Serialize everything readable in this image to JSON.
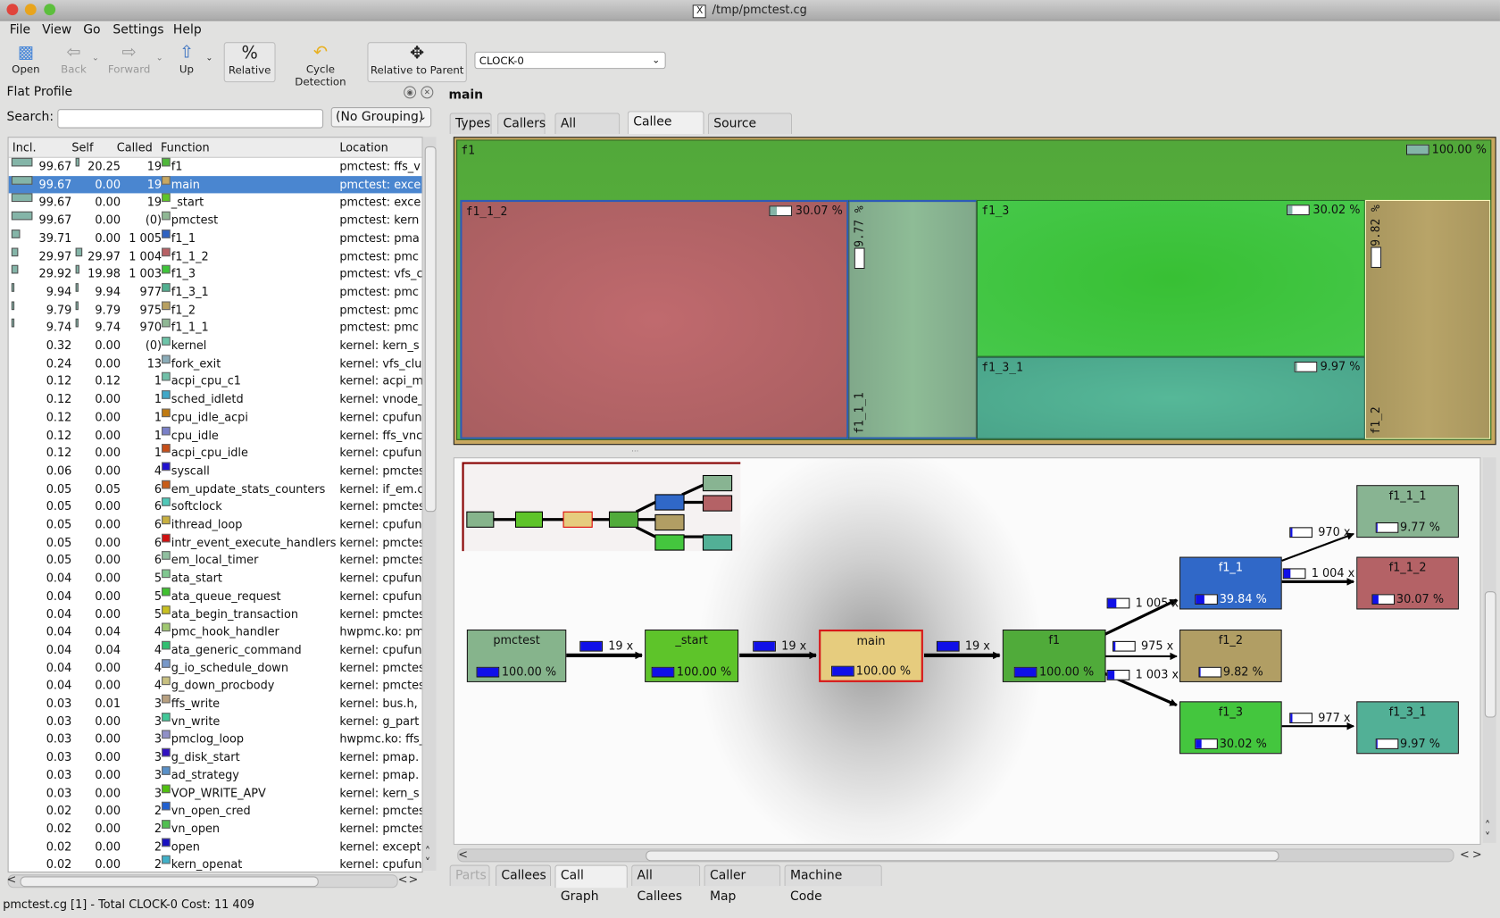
{
  "window": {
    "title": "/tmp/pmctest.cg"
  },
  "menu": [
    "File",
    "View",
    "Go",
    "Settings",
    "Help"
  ],
  "toolbar": {
    "open": "Open",
    "back": "Back",
    "forward": "Forward",
    "up": "Up",
    "relative": "Relative",
    "cycle_detection": "Cycle Detection",
    "relative_to_parent": "Relative to Parent",
    "event_type": "CLOCK-0"
  },
  "flat_profile": {
    "title": "Flat Profile",
    "search_label": "Search:",
    "search_value": "",
    "grouping": "(No Grouping)",
    "columns": [
      "Incl.",
      "Self",
      "Called",
      "Function",
      "Location"
    ],
    "rows": [
      {
        "incl": "99.67",
        "self": "20.25",
        "called": "19",
        "func": "f1",
        "loc": "pmctest: ffs_v",
        "color": "#4fb83a",
        "ibar": 1.0,
        "sbar": 0.2
      },
      {
        "incl": "99.67",
        "self": "0.00",
        "called": "19",
        "func": "main",
        "loc": "pmctest: exce",
        "color": "#c8a860",
        "ibar": 1.0,
        "sbar": 0,
        "selected": true
      },
      {
        "incl": "99.67",
        "self": "0.00",
        "called": "19",
        "func": "_start",
        "loc": "pmctest: exce",
        "color": "#5ec42a",
        "ibar": 1.0,
        "sbar": 0
      },
      {
        "incl": "99.67",
        "self": "0.00",
        "called": "(0)",
        "func": "pmctest",
        "loc": "pmctest: kern",
        "color": "#8fb894",
        "ibar": 1.0,
        "sbar": 0
      },
      {
        "incl": "39.71",
        "self": "0.00",
        "called": "1 005",
        "func": "f1_1",
        "loc": "pmctest: pma",
        "color": "#2f62c2",
        "ibar": 0.4,
        "sbar": 0
      },
      {
        "incl": "29.97",
        "self": "29.97",
        "called": "1 004",
        "func": "f1_1_2",
        "loc": "pmctest: pmc",
        "color": "#b86064",
        "ibar": 0.3,
        "sbar": 0.3
      },
      {
        "incl": "29.92",
        "self": "19.98",
        "called": "1 003",
        "func": "f1_3",
        "loc": "pmctest: vfs_c",
        "color": "#3ec43a",
        "ibar": 0.3,
        "sbar": 0.2
      },
      {
        "incl": "9.94",
        "self": "9.94",
        "called": "977",
        "func": "f1_3_1",
        "loc": "pmctest: pmc",
        "color": "#50b090",
        "ibar": 0.1,
        "sbar": 0.1
      },
      {
        "incl": "9.79",
        "self": "9.79",
        "called": "975",
        "func": "f1_2",
        "loc": "pmctest: pmc",
        "color": "#b8a060",
        "ibar": 0.1,
        "sbar": 0.1
      },
      {
        "incl": "9.74",
        "self": "9.74",
        "called": "970",
        "func": "f1_1_1",
        "loc": "pmctest: pmc",
        "color": "#8fb894",
        "ibar": 0.1,
        "sbar": 0.1
      },
      {
        "incl": "0.32",
        "self": "0.00",
        "called": "(0)",
        "func": "kernel",
        "loc": "kernel: kern_s",
        "color": "#6cc4a8"
      },
      {
        "incl": "0.24",
        "self": "0.00",
        "called": "13",
        "func": "fork_exit",
        "loc": "kernel: vfs_clu",
        "color": "#8aacb8"
      },
      {
        "incl": "0.12",
        "self": "0.12",
        "called": "1",
        "func": "acpi_cpu_c1",
        "loc": "kernel: acpi_m",
        "color": "#70c0a8"
      },
      {
        "incl": "0.12",
        "self": "0.00",
        "called": "1",
        "func": "sched_idletd",
        "loc": "kernel: vnode_",
        "color": "#40a8c8"
      },
      {
        "incl": "0.12",
        "self": "0.00",
        "called": "1",
        "func": "cpu_idle_acpi",
        "loc": "kernel: cpufun",
        "color": "#c07a10"
      },
      {
        "incl": "0.12",
        "self": "0.00",
        "called": "1",
        "func": "cpu_idle",
        "loc": "kernel: ffs_vnc",
        "color": "#7a80c8"
      },
      {
        "incl": "0.12",
        "self": "0.00",
        "called": "1",
        "func": "acpi_cpu_idle",
        "loc": "kernel: cpufun",
        "color": "#c84e18"
      },
      {
        "incl": "0.06",
        "self": "0.00",
        "called": "4",
        "func": "syscall",
        "loc": "kernel: pmctes",
        "color": "#2010d0"
      },
      {
        "incl": "0.05",
        "self": "0.05",
        "called": "6",
        "func": "em_update_stats_counters",
        "loc": "kernel: if_em.c",
        "color": "#c85c18"
      },
      {
        "incl": "0.05",
        "self": "0.00",
        "called": "6",
        "func": "softclock",
        "loc": "kernel: pmctes",
        "color": "#50c8b8"
      },
      {
        "incl": "0.05",
        "self": "0.00",
        "called": "6",
        "func": "ithread_loop",
        "loc": "kernel: cpufun",
        "color": "#c8b040"
      },
      {
        "incl": "0.05",
        "self": "0.00",
        "called": "6",
        "func": "intr_event_execute_handlers",
        "loc": "kernel: pmctes",
        "color": "#d01010"
      },
      {
        "incl": "0.05",
        "self": "0.00",
        "called": "6",
        "func": "em_local_timer",
        "loc": "kernel: pmctes",
        "color": "#90c0a0"
      },
      {
        "incl": "0.04",
        "self": "0.00",
        "called": "5",
        "func": "ata_start",
        "loc": "kernel: cpufun",
        "color": "#80c890"
      },
      {
        "incl": "0.04",
        "self": "0.00",
        "called": "5",
        "func": "ata_queue_request",
        "loc": "kernel: cpufun",
        "color": "#40c030"
      },
      {
        "incl": "0.04",
        "self": "0.00",
        "called": "5",
        "func": "ata_begin_transaction",
        "loc": "kernel: pmctes",
        "color": "#c8c020"
      },
      {
        "incl": "0.04",
        "self": "0.04",
        "called": "4",
        "func": "pmc_hook_handler",
        "loc": "hwpmc.ko: pm",
        "color": "#a0c870"
      },
      {
        "incl": "0.04",
        "self": "0.04",
        "called": "4",
        "func": "ata_generic_command",
        "loc": "kernel: cpufun",
        "color": "#30c070"
      },
      {
        "incl": "0.04",
        "self": "0.00",
        "called": "4",
        "func": "g_io_schedule_down",
        "loc": "kernel: pmctes",
        "color": "#7898c8"
      },
      {
        "incl": "0.04",
        "self": "0.00",
        "called": "4",
        "func": "g_down_procbody",
        "loc": "kernel: pmctes",
        "color": "#c8c080"
      },
      {
        "incl": "0.03",
        "self": "0.01",
        "called": "3",
        "func": "ffs_write",
        "loc": "kernel: bus.h,",
        "color": "#b8a080"
      },
      {
        "incl": "0.03",
        "self": "0.00",
        "called": "3",
        "func": "vn_write",
        "loc": "kernel: g_part",
        "color": "#40c898"
      },
      {
        "incl": "0.03",
        "self": "0.00",
        "called": "3",
        "func": "pmclog_loop",
        "loc": "hwpmc.ko: ffs_",
        "color": "#9090c8"
      },
      {
        "incl": "0.03",
        "self": "0.00",
        "called": "3",
        "func": "g_disk_start",
        "loc": "kernel: pmap.",
        "color": "#3010c0"
      },
      {
        "incl": "0.03",
        "self": "0.00",
        "called": "3",
        "func": "ad_strategy",
        "loc": "kernel: pmap.",
        "color": "#5890c8"
      },
      {
        "incl": "0.03",
        "self": "0.00",
        "called": "3",
        "func": "VOP_WRITE_APV",
        "loc": "kernel: kern_s",
        "color": "#50c010"
      },
      {
        "incl": "0.02",
        "self": "0.00",
        "called": "2",
        "func": "vn_open_cred",
        "loc": "kernel: pmctes",
        "color": "#2060d0"
      },
      {
        "incl": "0.02",
        "self": "0.00",
        "called": "2",
        "func": "vn_open",
        "loc": "kernel: pmctes",
        "color": "#50c050"
      },
      {
        "incl": "0.02",
        "self": "0.00",
        "called": "2",
        "func": "open",
        "loc": "kernel: except",
        "color": "#1810c0"
      },
      {
        "incl": "0.02",
        "self": "0.00",
        "called": "2",
        "func": "kern_openat",
        "loc": "kernel: cpufun",
        "color": "#40b0c8"
      }
    ]
  },
  "detail": {
    "function": "main",
    "top_tabs": [
      "Types",
      "Callers",
      "All Callers",
      "Callee Map",
      "Source Code"
    ],
    "top_active": "Callee Map",
    "bottom_tabs": [
      "Parts",
      "Callees",
      "Call Graph",
      "All Callees",
      "Caller Map",
      "Machine Code"
    ],
    "bottom_active": "Call Graph",
    "treemap": {
      "f1": {
        "label": "f1",
        "pct": "100.00 %",
        "frac": 1.0
      },
      "f1_1_2": {
        "label": "f1_1_2",
        "pct": "30.07 %",
        "frac": 0.3
      },
      "f1_1_1": {
        "label": "f1_1_1",
        "pct": "9.77 %",
        "frac": 0.1
      },
      "f1_3": {
        "label": "f1_3",
        "pct": "30.02 %",
        "frac": 0.2
      },
      "f1_3_1": {
        "label": "f1_3_1",
        "pct": "9.97 %",
        "frac": 0.05
      },
      "f1_2": {
        "label": "f1_2",
        "pct": "9.82 %",
        "frac": 0.05
      }
    },
    "callgraph": {
      "nodes": {
        "pmctest": {
          "name": "pmctest",
          "pct": "100.00 %",
          "frac": 1.0,
          "color": "#86b48c"
        },
        "start": {
          "name": "_start",
          "pct": "100.00 %",
          "frac": 1.0,
          "color": "#5ec42a"
        },
        "main": {
          "name": "main",
          "pct": "100.00 %",
          "frac": 1.0,
          "color": "#e6cc7e"
        },
        "f1": {
          "name": "f1",
          "pct": "100.00 %",
          "frac": 1.0,
          "color": "#50ab3a"
        },
        "f1_1": {
          "name": "f1_1",
          "pct": "39.84 %",
          "frac": 0.4,
          "color": "#3068c8"
        },
        "f1_2": {
          "name": "f1_2",
          "pct": "9.82 %",
          "frac": 0.05,
          "color": "#b19e64"
        },
        "f1_3": {
          "name": "f1_3",
          "pct": "30.02 %",
          "frac": 0.3,
          "color": "#44c63e"
        },
        "f1_1_1": {
          "name": "f1_1_1",
          "pct": "9.77 %",
          "frac": 0.05,
          "color": "#88b492"
        },
        "f1_1_2": {
          "name": "f1_1_2",
          "pct": "30.07 %",
          "frac": 0.3,
          "color": "#b46266"
        },
        "f1_3_1": {
          "name": "f1_3_1",
          "pct": "9.97 %",
          "frac": 0.05,
          "color": "#52b096"
        }
      },
      "edges": {
        "pmctest_start": {
          "calls": "19 x",
          "frac": 1.0
        },
        "start_main": {
          "calls": "19 x",
          "frac": 1.0
        },
        "main_f1": {
          "calls": "19 x",
          "frac": 1.0
        },
        "f1_f1_1": {
          "calls": "1 005 x",
          "frac": 0.4
        },
        "f1_f1_2": {
          "calls": "975 x",
          "frac": 0.05
        },
        "f1_f1_3": {
          "calls": "1 003 x",
          "frac": 0.3
        },
        "f1_1_f1_1_1": {
          "calls": "970 x",
          "frac": 0.05
        },
        "f1_1_f1_1_2": {
          "calls": "1 004 x",
          "frac": 0.3
        },
        "f1_3_f1_3_1": {
          "calls": "977 x",
          "frac": 0.05
        }
      }
    }
  },
  "status": "pmctest.cg [1] - Total CLOCK-0 Cost:  11 409"
}
